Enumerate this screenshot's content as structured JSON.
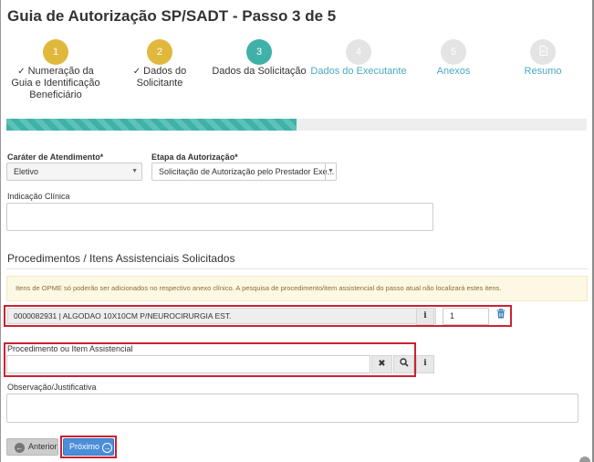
{
  "page": {
    "title": "Guia de Autorização SP/SADT - Passo 3 de 5"
  },
  "wizard": {
    "steps": [
      {
        "number": "1",
        "label": "Numeração da Guia e Identificação Beneficiário",
        "status": "done"
      },
      {
        "number": "2",
        "label": "Dados do Solicitante",
        "status": "done"
      },
      {
        "number": "3",
        "label": "Dados da Solicitação",
        "status": "active"
      },
      {
        "number": "4",
        "label": "Dados do Executante",
        "status": "pending"
      },
      {
        "number": "5",
        "label": "Anexos",
        "status": "pending"
      },
      {
        "icon": "document-icon",
        "label": "Resumo",
        "status": "pending"
      }
    ],
    "progress_fraction": 0.5,
    "colors": {
      "done": "#e0b83c",
      "active": "#3fb1a8",
      "pending": "#e4e4e4",
      "link": "#4aa9c7"
    }
  },
  "form": {
    "carater_label": "Caráter de Atendimento*",
    "carater_value": "Eletivo",
    "etapa_label": "Etapa da Autorização*",
    "etapa_value": "Solicitação de Autorização pelo Prestador Exe...",
    "indicacao_label": "Indicação Clínica"
  },
  "procedures": {
    "section_title": "Procedimentos / Itens Assistenciais Solicitados",
    "alert": "Itens de OPME só poderão ser adicionados no respectivo anexo clínico. A pesquisa de procedimento/item assistencial do passo atual não localizará estes itens.",
    "item": {
      "description": "0000082931 | ALGODAO 10X10CM P/NEUROCIRURGIA EST.",
      "quantity": "1"
    },
    "search_label": "Procedimento ou Item Assistencial"
  },
  "observacao_label": "Observação/Justificativa",
  "buttons": {
    "previous": "Anterior",
    "next": "Próximo"
  },
  "accent_colors": {
    "highlight": "#cc2233",
    "primary": "#4c8dd9"
  }
}
